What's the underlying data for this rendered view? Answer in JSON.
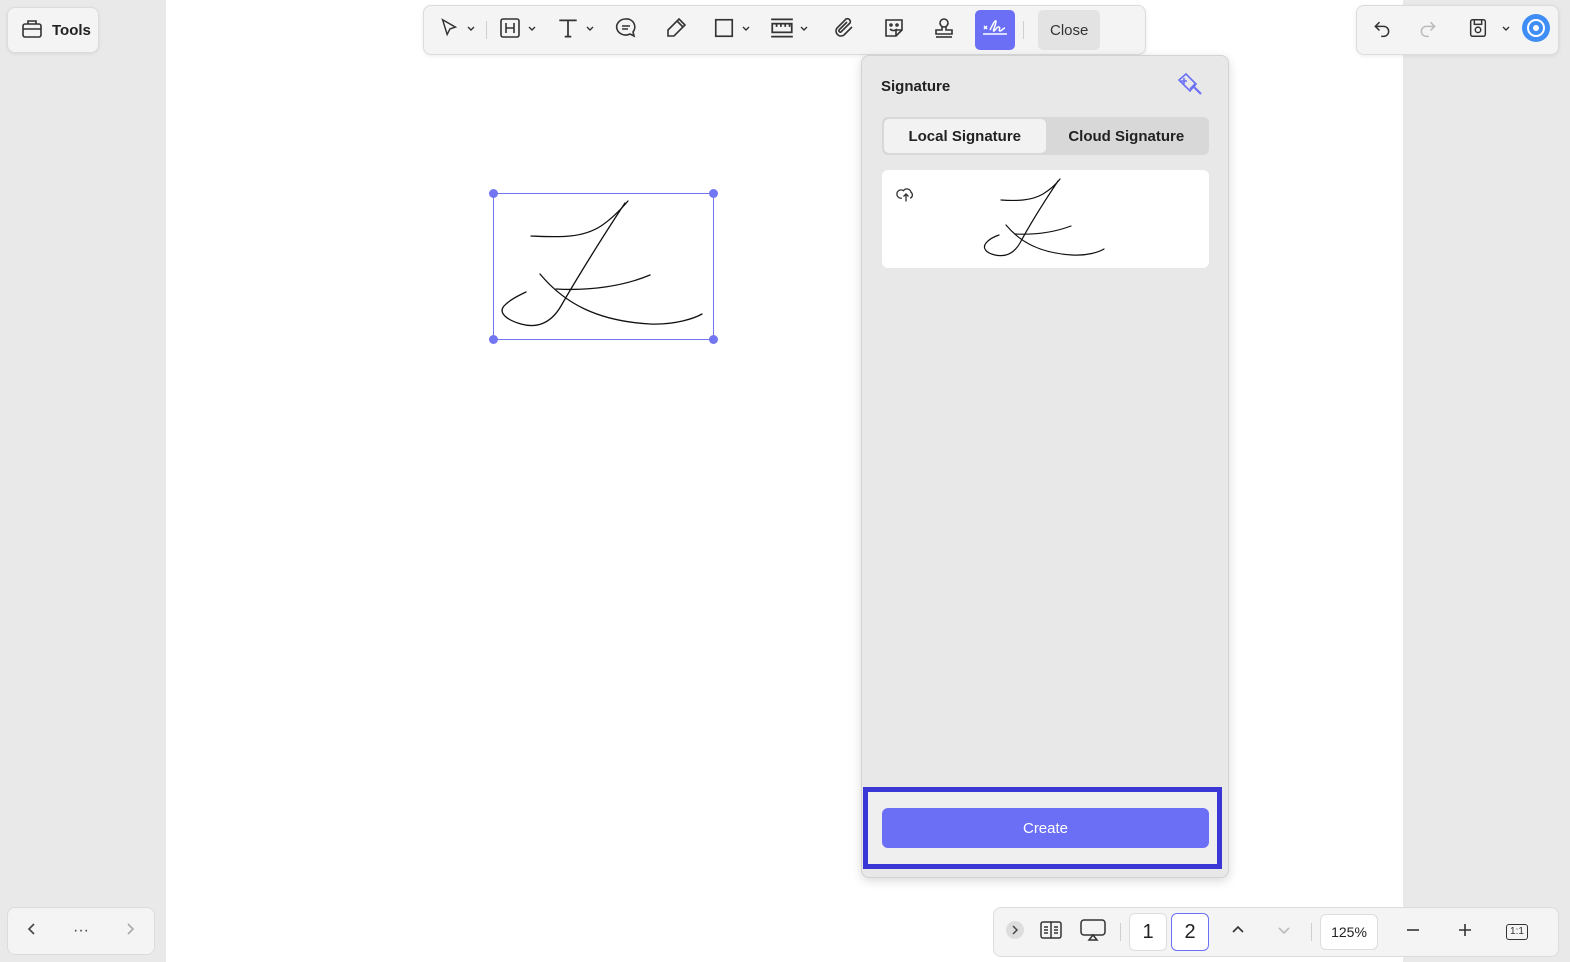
{
  "tools": {
    "label": "Tools"
  },
  "toolbar": {
    "close_label": "Close"
  },
  "signature_panel": {
    "title": "Signature",
    "tabs": [
      {
        "label": "Local Signature",
        "active": true
      },
      {
        "label": "Cloud Signature",
        "active": false
      }
    ],
    "create_label": "Create"
  },
  "nav": {
    "prev": "‹",
    "more": "···",
    "next": "›"
  },
  "bottom": {
    "pages": [
      "1",
      "2"
    ],
    "current_page": "2",
    "zoom": "125%",
    "fit_label": "1:1"
  },
  "colors": {
    "accent": "#6b6ff5",
    "highlight": "#3b36d6"
  }
}
